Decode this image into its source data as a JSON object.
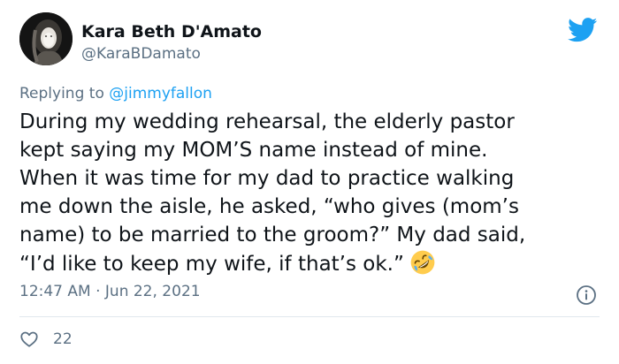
{
  "author": {
    "display_name": "Kara Beth D'Amato",
    "handle": "@KaraBDamato",
    "avatar_icon": "profile-photo"
  },
  "brand": {
    "icon": "twitter-bird-icon",
    "color": "#1da1f2"
  },
  "reply": {
    "prefix": "Replying to ",
    "mention": "@jimmyfallon"
  },
  "tweet": {
    "lines": [
      "During my wedding rehearsal, the elderly pastor",
      "kept saying my MOM’S name instead of mine.",
      "When it was time for my dad to practice walking",
      "me down the aisle, he asked, “who gives (mom’s",
      "name) to be married to the groom?” My dad said,",
      "“I’d like to keep my wife, if that’s ok.”"
    ],
    "emoji": "rolling-on-floor-laughing-emoji"
  },
  "meta": {
    "timestamp": "12:47 AM · Jun 22, 2021",
    "info_icon": "info-icon"
  },
  "engagement": {
    "like_icon": "heart-icon",
    "like_count": "22"
  },
  "colors": {
    "text": "#0f1419",
    "secondary": "#5b7083",
    "accent": "#1da1f2",
    "divider": "#e1e8ed"
  }
}
